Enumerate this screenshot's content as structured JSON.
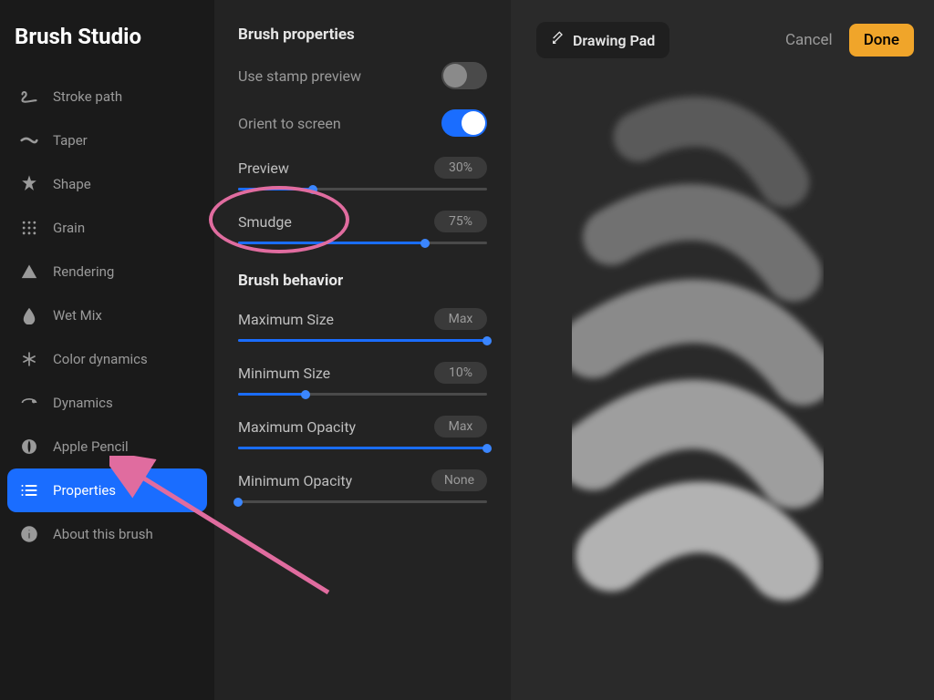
{
  "header": {
    "title": "Brush Studio"
  },
  "sidebar": {
    "items": [
      {
        "id": "stroke-path",
        "label": "Stroke path",
        "icon": "stroke-path"
      },
      {
        "id": "taper",
        "label": "Taper",
        "icon": "taper"
      },
      {
        "id": "shape",
        "label": "Shape",
        "icon": "shape"
      },
      {
        "id": "grain",
        "label": "Grain",
        "icon": "grain"
      },
      {
        "id": "rendering",
        "label": "Rendering",
        "icon": "rendering"
      },
      {
        "id": "wet-mix",
        "label": "Wet Mix",
        "icon": "wet-mix"
      },
      {
        "id": "color-dyn",
        "label": "Color dynamics",
        "icon": "color-dynamics"
      },
      {
        "id": "dynamics",
        "label": "Dynamics",
        "icon": "dynamics"
      },
      {
        "id": "apple-pencil",
        "label": "Apple Pencil",
        "icon": "apple-pencil"
      },
      {
        "id": "properties",
        "label": "Properties",
        "icon": "properties",
        "active": true
      },
      {
        "id": "about",
        "label": "About this brush",
        "icon": "about"
      }
    ]
  },
  "panel": {
    "section1_title": "Brush properties",
    "toggles": [
      {
        "id": "stamp-preview",
        "label": "Use stamp preview",
        "on": false
      },
      {
        "id": "orient-screen",
        "label": "Orient to screen",
        "on": true
      }
    ],
    "sliders1": [
      {
        "id": "preview",
        "label": "Preview",
        "value_text": "30%",
        "percent": 30
      },
      {
        "id": "smudge",
        "label": "Smudge",
        "value_text": "75%",
        "percent": 75,
        "highlighted": true
      }
    ],
    "section2_title": "Brush behavior",
    "sliders2": [
      {
        "id": "max-size",
        "label": "Maximum Size",
        "value_text": "Max",
        "percent": 100
      },
      {
        "id": "min-size",
        "label": "Minimum Size",
        "value_text": "10%",
        "percent": 27
      },
      {
        "id": "max-opacity",
        "label": "Maximum Opacity",
        "value_text": "Max",
        "percent": 100
      },
      {
        "id": "min-opacity",
        "label": "Minimum Opacity",
        "value_text": "None",
        "percent": 0
      }
    ]
  },
  "preview": {
    "drawing_pad_label": "Drawing Pad",
    "cancel_label": "Cancel",
    "done_label": "Done"
  },
  "colors": {
    "accent": "#1a6dff",
    "annotation": "#e06c9f",
    "done_button": "#f0a52a"
  }
}
